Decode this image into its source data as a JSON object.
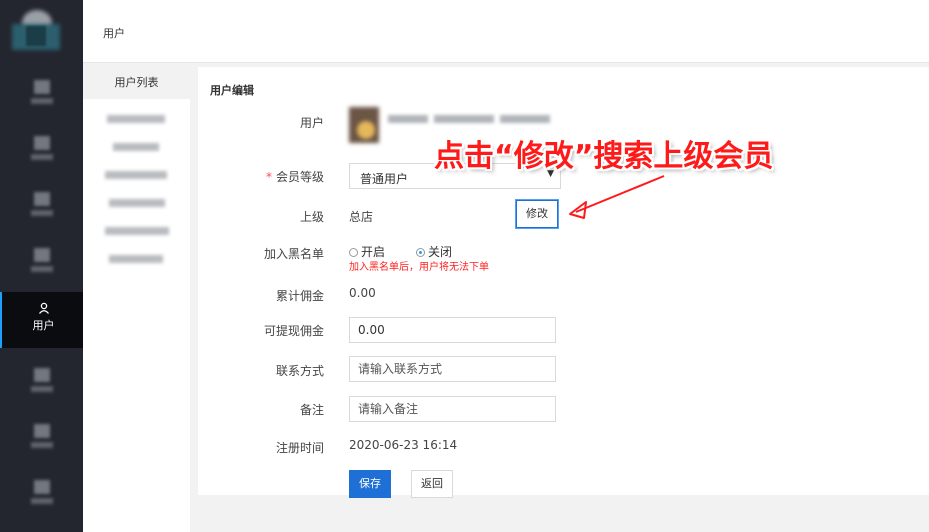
{
  "header": {
    "title": "用户"
  },
  "leftnav": {
    "active_label": "用户",
    "active_icon": "user-icon"
  },
  "subnav": {
    "head": "用户列表"
  },
  "panel": {
    "title": "用户编辑",
    "user_label": "用户",
    "level_label": "会员等级",
    "level_value": "普通用户",
    "parent_label": "上级",
    "parent_value": "总店",
    "edit_button": "修改",
    "blacklist_label": "加入黑名单",
    "blacklist_on": "开启",
    "blacklist_off": "关闭",
    "blacklist_warning": "加入黑名单后，用户将无法下单",
    "commission_total_label": "累计佣金",
    "commission_total_value": "0.00",
    "withdrawable_label": "可提现佣金",
    "withdrawable_value": "0.00",
    "contact_label": "联系方式",
    "contact_placeholder": "请输入联系方式",
    "remark_label": "备注",
    "remark_placeholder": "请输入备注",
    "regtime_label": "注册时间",
    "regtime_value": "2020-06-23 16:14",
    "save_button": "保存",
    "back_button": "返回"
  },
  "annotation": {
    "text": "点击“修改”搜索上级会员",
    "color": "#ff1a1a"
  },
  "colors": {
    "primary": "#1e6fd6",
    "nav_bg": "#23262e",
    "warning": "#ff2222"
  }
}
